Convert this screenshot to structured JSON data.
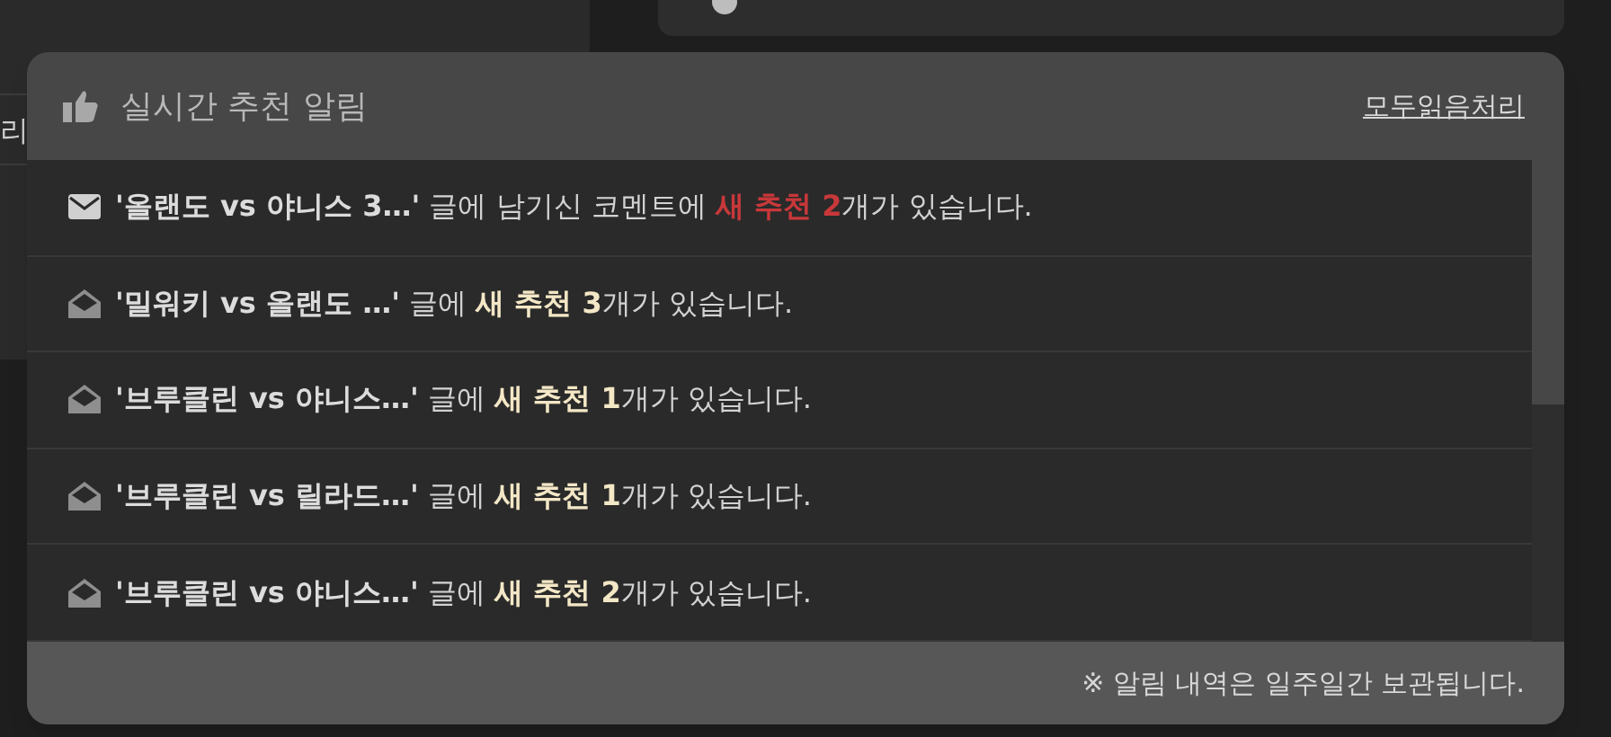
{
  "background": {
    "cell_text": "리"
  },
  "panel": {
    "title": "실시간 추천 알림",
    "mark_all_read": "모두읽음처리",
    "items": [
      {
        "read": false,
        "title": "'올랜도 vs 야니스 3…'",
        "text": " 글에 남기신 코멘트에 ",
        "highlight": "새 추천 2",
        "suffix": "개가 있습니다."
      },
      {
        "read": true,
        "title": "'밀워키 vs 올랜도 …'",
        "text": " 글에 ",
        "highlight": "새 추천 3",
        "suffix": "개가 있습니다."
      },
      {
        "read": true,
        "title": "'브루클린 vs 야니스…'",
        "text": " 글에 ",
        "highlight": "새 추천 1",
        "suffix": "개가 있습니다."
      },
      {
        "read": true,
        "title": "'브루클린 vs 릴라드…'",
        "text": " 글에 ",
        "highlight": "새 추천 1",
        "suffix": "개가 있습니다."
      },
      {
        "read": true,
        "title": "'브루클린 vs 야니스…'",
        "text": " 글에 ",
        "highlight": "새 추천 2",
        "suffix": "개가 있습니다."
      }
    ],
    "footer": "※ 알림 내역은 일주일간 보관됩니다."
  }
}
